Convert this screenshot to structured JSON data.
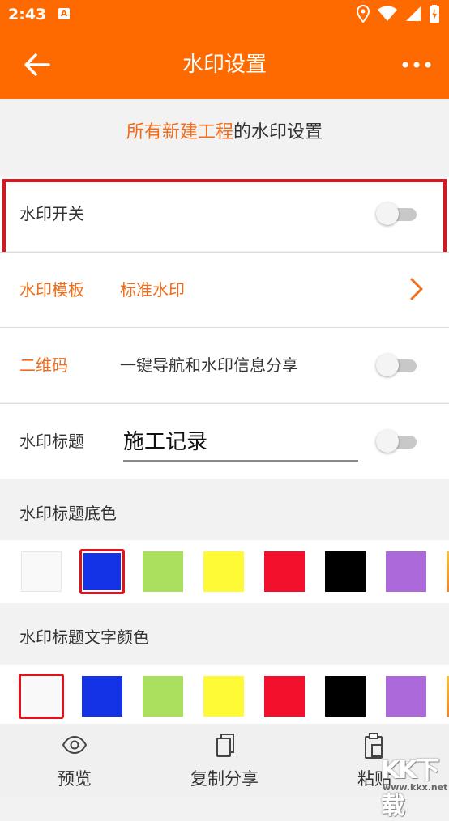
{
  "status_bar": {
    "time": "2:43",
    "app_badge": "A"
  },
  "app_bar": {
    "title": "水印设置"
  },
  "subtitle": {
    "highlight": "所有新建工程",
    "rest": "的水印设置"
  },
  "rows": {
    "watermark_switch": {
      "label": "水印开关",
      "on": false
    },
    "template": {
      "label": "水印模板",
      "value": "标准水印"
    },
    "qrcode": {
      "label": "二维码",
      "value": "一键导航和水印信息分享",
      "on": false
    },
    "title": {
      "label": "水印标题",
      "value": "施工记录",
      "on": false
    }
  },
  "sections": {
    "bg_color": {
      "label": "水印标题底色"
    },
    "text_color": {
      "label": "水印标题文字颜色"
    }
  },
  "colors": {
    "accent": "#ff6a00",
    "bg_swatches": [
      "#f9f9f9",
      "#1432e6",
      "#abe05e",
      "#fffa36",
      "#f2102d",
      "#000000",
      "#ac69d9",
      "#f3b33a"
    ],
    "bg_selected_index": 1,
    "text_swatches": [
      "#f9f9f9",
      "#1432e6",
      "#abe05e",
      "#fffa36",
      "#f2102d",
      "#000000",
      "#ac69d9",
      "#f3b33a"
    ],
    "text_selected_index": 0
  },
  "bottom_nav": {
    "preview": "预览",
    "copy_share": "复制分享",
    "paste": "粘贴"
  },
  "watermark": {
    "logo": "KK下载",
    "url": "www.kkx.net"
  }
}
